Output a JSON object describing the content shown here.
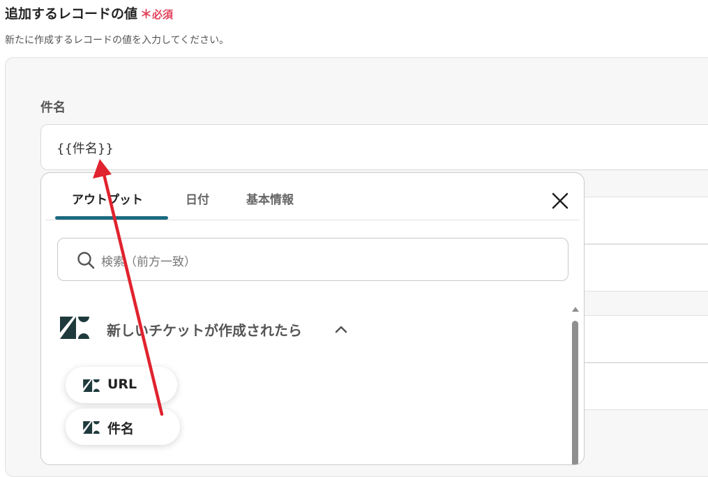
{
  "section": {
    "title": "追加するレコードの値",
    "required_mark": "＊",
    "required_label": "必須",
    "description": "新たに作成するレコードの値を入力してください。"
  },
  "field": {
    "label": "件名",
    "value": "{{件名}}"
  },
  "popup": {
    "tabs": [
      {
        "label": "アウトプット",
        "active": true
      },
      {
        "label": "日付",
        "active": false
      },
      {
        "label": "基本情報",
        "active": false
      }
    ],
    "search_placeholder": "検索（前方一致）",
    "group": {
      "title": "新しいチケットが作成されたら",
      "icon": "zendesk-logo",
      "expanded": true
    },
    "outputs": [
      {
        "label": "URL"
      },
      {
        "label": "件名"
      }
    ]
  },
  "colors": {
    "accent": "#1b6a80",
    "required": "#e2415a",
    "annotation_arrow": "#e0232e",
    "logo": "#1f3a3d"
  }
}
